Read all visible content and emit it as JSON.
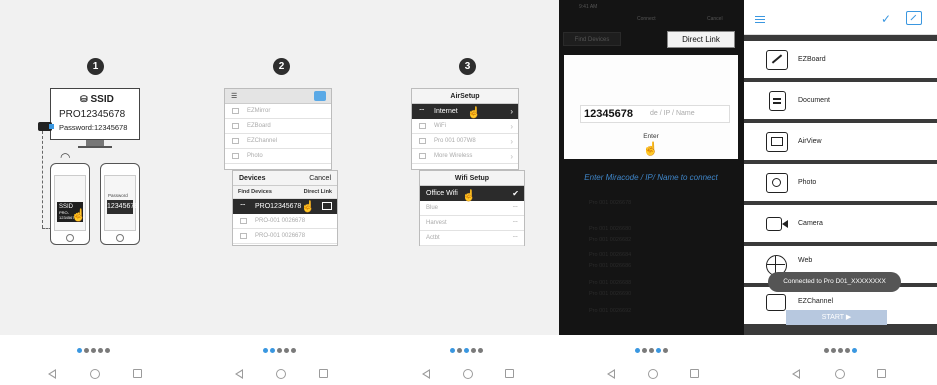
{
  "panel1": {
    "step": "1",
    "monitor": {
      "ssid_label": "SSID",
      "pro_id": "PRO12345678",
      "password_line": "Password:12345678"
    },
    "phone_left": {
      "ssid": "SSID",
      "pro_id": "PRO-12345678"
    },
    "phone_right": {
      "password_label": "Password",
      "password_value": "12345678"
    }
  },
  "panel2": {
    "step": "2",
    "menu_rows": [
      "EZMirror",
      "EZBoard",
      "EZChannel",
      "Photo"
    ],
    "devices_title": "Devices",
    "cancel_label": "Cancel",
    "find_devices": "Find Devices",
    "direct_link": "Direct Link",
    "selected_device": "PRO12345678",
    "other_devices": [
      "PRO-001 0026678",
      "PRO-001 0026678"
    ]
  },
  "panel3": {
    "step": "3",
    "airsetup_title": "AirSetup",
    "internet_label": "Internet",
    "menu_rows": [
      "WiFi",
      "Pro 001 007W8",
      "More Wireless"
    ],
    "wifi_setup_title": "Wifi Setup",
    "office_wifi": "Office Wifi",
    "other_networks": [
      "Blue",
      "Harvest",
      "Actbt"
    ]
  },
  "panel4": {
    "top_status": "9:41 AM",
    "top_title": "Connect",
    "top_right": "Cancel",
    "tab_label": "Find Devices",
    "direct_link_label": "Direct Link",
    "code_value": "12345678",
    "code_placeholder": "de / IP / Name",
    "enter_label": "Enter",
    "hint": "Enter Miracode / IP/ Name to connect",
    "list_rows": [
      "Pro 001 0026678",
      "Pro 001 0026680",
      "Pro 001 0026682",
      "Pro 001 0026684",
      "Pro 001 0026686",
      "Pro 001 0026688",
      "Pro 001 0026690",
      "Pro 001 0026692"
    ]
  },
  "panel5": {
    "items": [
      {
        "label": "EZBoard",
        "icon": "ezboard-icon"
      },
      {
        "label": "Document",
        "icon": "document-icon"
      },
      {
        "label": "AirView",
        "icon": "airview-icon"
      },
      {
        "label": "Photo",
        "icon": "photo-icon"
      },
      {
        "label": "Camera",
        "icon": "camera-icon"
      },
      {
        "label": "Web",
        "icon": "web-icon"
      },
      {
        "label": "EZChannel",
        "icon": "ezchannel-icon"
      }
    ],
    "toast": "Connected to Pro D01_XXXXXXXX",
    "start_label": "START ▶"
  },
  "pager": {
    "active_indices": [
      0,
      1,
      2,
      3,
      4
    ],
    "count": 5
  },
  "colors": {
    "accent": "#3a97e0",
    "dark": "#2b2b2b",
    "hint_text": "#3f86c9"
  }
}
